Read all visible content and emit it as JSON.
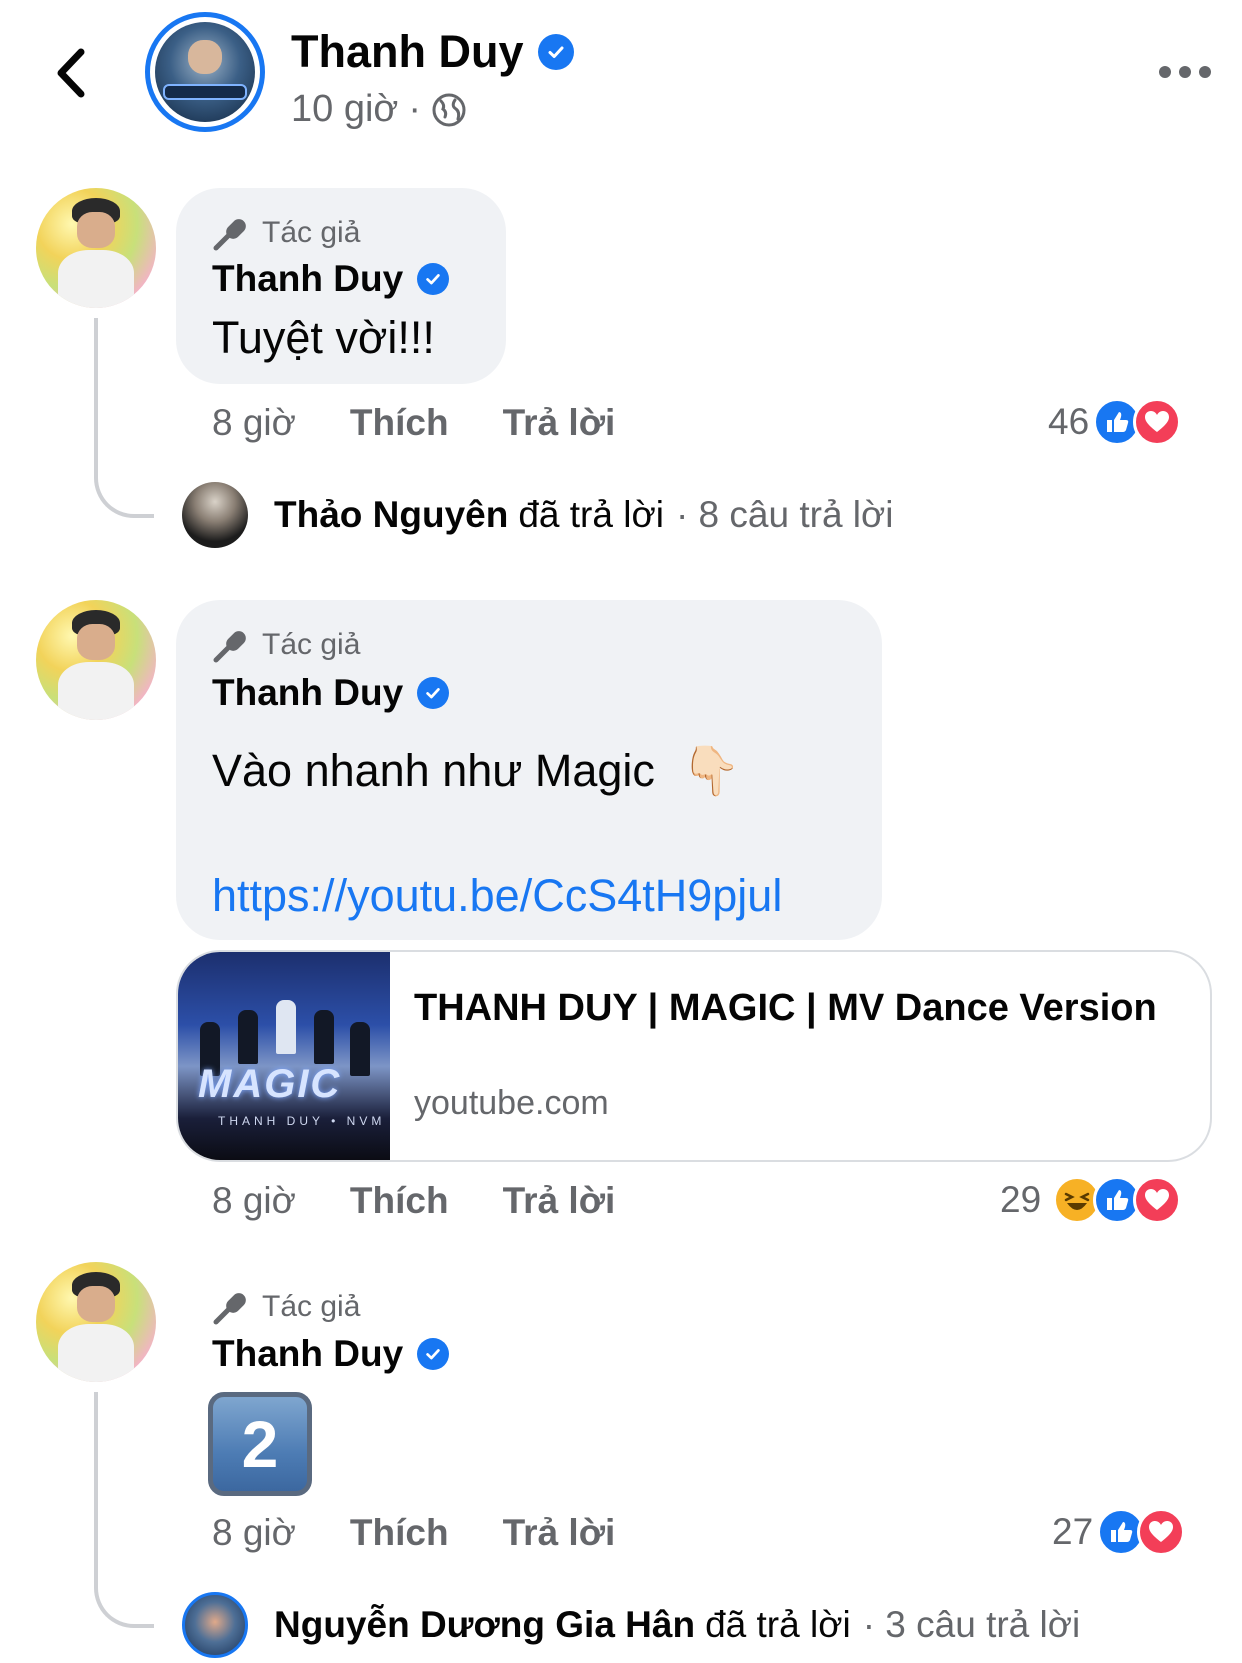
{
  "header": {
    "name": "Thanh Duy",
    "time": "10 giờ",
    "separator": "·"
  },
  "author_badge_label": "Tác giả",
  "comments": [
    {
      "name": "Thanh Duy",
      "text": "Tuyệt vời!!!",
      "time": "8 giờ",
      "like_label": "Thích",
      "reply_label": "Trả lời",
      "reaction_count": "46",
      "reactions": [
        "like",
        "love"
      ],
      "reply_summary": {
        "name": "Thảo Nguyên",
        "action": "đã trả lời",
        "count": "· 8 câu trả lời"
      }
    },
    {
      "name": "Thanh Duy",
      "text": "Vào nhanh như Magic",
      "emoji": "👇🏻",
      "link": "https://youtu.be/CcS4tH9pjul",
      "preview": {
        "title": "THANH DUY | MAGIC | MV Dance Version",
        "domain": "youtube.com",
        "thumb_text": "MAGIC",
        "thumb_sub": "THANH DUY • NVM"
      },
      "time": "8 giờ",
      "like_label": "Thích",
      "reply_label": "Trả lời",
      "reaction_count": "29",
      "reactions": [
        "haha",
        "like",
        "love"
      ]
    },
    {
      "name": "Thanh Duy",
      "keycap": "2",
      "time": "8 giờ",
      "like_label": "Thích",
      "reply_label": "Trả lời",
      "reaction_count": "27",
      "reactions": [
        "like",
        "love"
      ],
      "reply_summary": {
        "name": "Nguyễn Dương Gia Hân",
        "action": "đã trả lời",
        "count": "· 3 câu trả lời"
      }
    }
  ],
  "colors": {
    "brand_blue": "#1877F2",
    "love_red": "#F33E58",
    "haha_yellow": "#F7B125",
    "secondary_text": "#65676B",
    "bubble_bg": "#F0F2F5"
  },
  "icons": [
    "back-chevron-icon",
    "verified-badge-icon",
    "globe-icon",
    "more-options-icon",
    "microphone-icon",
    "like-reaction-icon",
    "love-reaction-icon",
    "haha-reaction-icon"
  ]
}
